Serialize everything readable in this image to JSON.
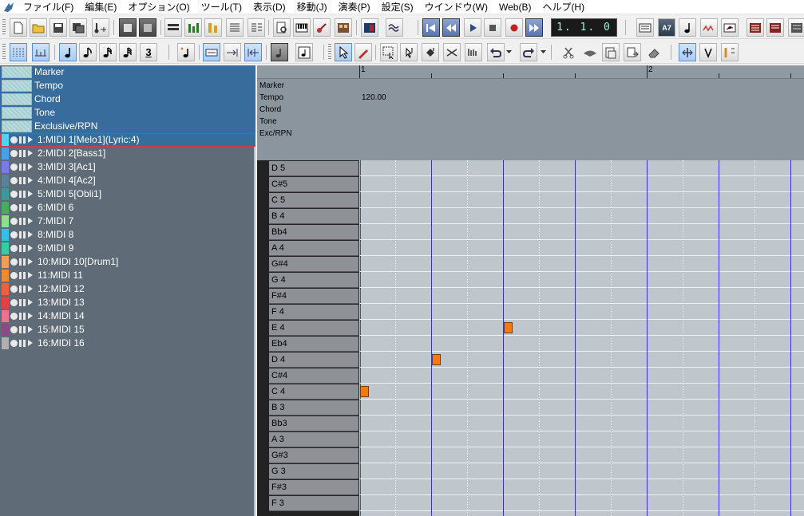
{
  "menu": {
    "items": [
      "ファイル(F)",
      "編集(E)",
      "オプション(O)",
      "ツール(T)",
      "表示(D)",
      "移動(J)",
      "演奏(P)",
      "設定(S)",
      "ウインドウ(W)",
      "Web(B)",
      "ヘルプ(H)"
    ]
  },
  "transport": {
    "position": "1.  1.   0"
  },
  "toolbar_labels": {
    "triplet": "3",
    "chord_badge": "A7"
  },
  "conductor_tracks": [
    "Marker",
    "Tempo",
    "Chord",
    "Tone",
    "Exclusive/RPN"
  ],
  "tracks": [
    {
      "label": "1:MIDI 1[Melo1](Lyric:4)",
      "color": "#5ad0f0"
    },
    {
      "label": "2:MIDI 2[Bass1]",
      "color": "#4aa0e8"
    },
    {
      "label": "3:MIDI 3[Ac1]",
      "color": "#7a7ae8"
    },
    {
      "label": "4:MIDI 4[Ac2]",
      "color": "#5a80a0"
    },
    {
      "label": "5:MIDI 5[Obli1]",
      "color": "#3a9a9a"
    },
    {
      "label": "6:MIDI 6",
      "color": "#4aaa60"
    },
    {
      "label": "7:MIDI 7",
      "color": "#8ee08a"
    },
    {
      "label": "8:MIDI 8",
      "color": "#30c0e8"
    },
    {
      "label": "9:MIDI 9",
      "color": "#30d0a0"
    },
    {
      "label": "10:MIDI 10[Drum1]",
      "color": "#f0a050"
    },
    {
      "label": "11:MIDI 11",
      "color": "#f08a30"
    },
    {
      "label": "12:MIDI 12",
      "color": "#f06040"
    },
    {
      "label": "13:MIDI 13",
      "color": "#e84040"
    },
    {
      "label": "14:MIDI 14",
      "color": "#f07090"
    },
    {
      "label": "15:MIDI 15",
      "color": "#8a4a8a"
    },
    {
      "label": "16:MIDI 16",
      "color": "#b0b0b0"
    }
  ],
  "ruler": {
    "measures": [
      "1",
      "2"
    ]
  },
  "conductor_view": {
    "labels": [
      "Marker",
      "Tempo",
      "Chord",
      "Tone",
      "Exc/RPN"
    ],
    "tempo_value": "120.00"
  },
  "piano_roll": {
    "keys": [
      "D 5",
      "C#5",
      "C 5",
      "B 4",
      "Bb4",
      "A 4",
      "G#4",
      "G 4",
      "F#4",
      "F 4",
      "E 4",
      "Eb4",
      "D 4",
      "C#4",
      "C 4",
      "B 3",
      "Bb3",
      "A 3",
      "G#3",
      "G 3",
      "F#3",
      "F 3"
    ],
    "notes": [
      {
        "pitch": "C 4",
        "beat": 1
      },
      {
        "pitch": "D 4",
        "beat": 2
      },
      {
        "pitch": "E 4",
        "beat": 3
      }
    ]
  }
}
